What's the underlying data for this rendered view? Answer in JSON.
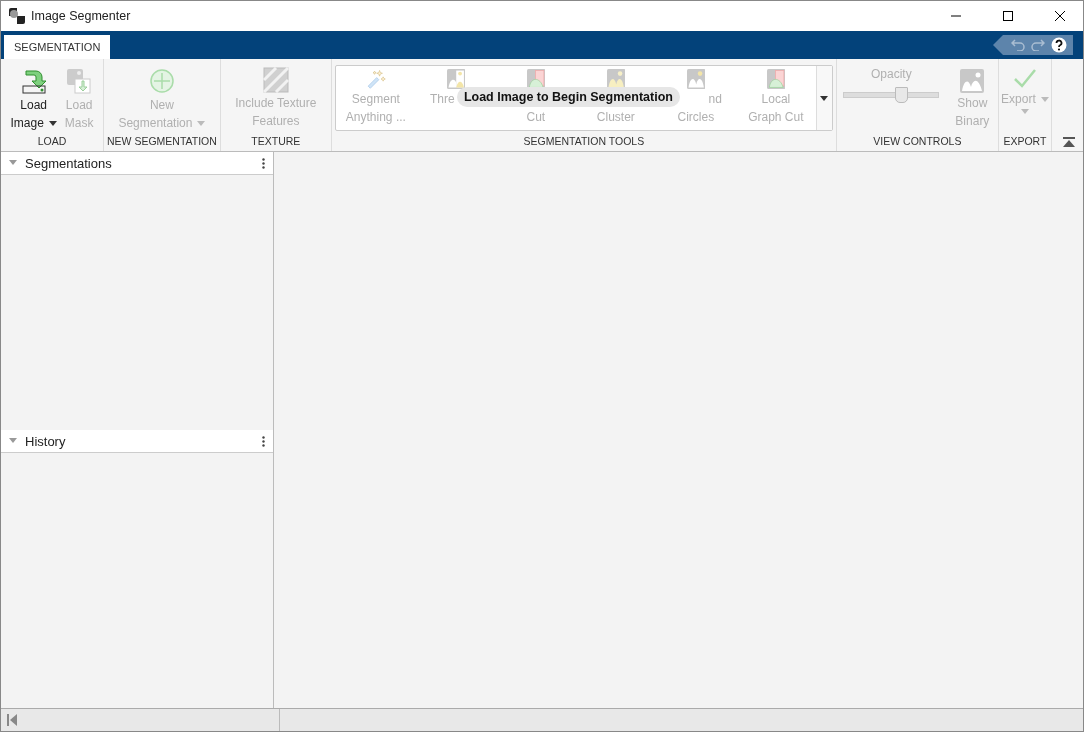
{
  "window": {
    "title": "Image Segmenter"
  },
  "tabs": [
    {
      "label": "SEGMENTATION",
      "selected": true
    }
  ],
  "sections": [
    {
      "label": "LOAD",
      "buttons": [
        {
          "kind": "load-image",
          "lines": [
            "Load",
            "Image"
          ],
          "dropdown": true,
          "disabled": false
        },
        {
          "kind": "load-mask",
          "lines": [
            "Load",
            "Mask"
          ],
          "dropdown": false,
          "disabled": true
        }
      ]
    },
    {
      "label": "NEW SEGMENTATION",
      "buttons": [
        {
          "kind": "new",
          "lines": [
            "New",
            "Segmentation"
          ],
          "dropdown": true,
          "disabled": true
        }
      ]
    },
    {
      "label": "TEXTURE",
      "buttons": [
        {
          "kind": "texture",
          "lines": [
            "Include Texture",
            "Features"
          ],
          "dropdown": false,
          "disabled": true
        }
      ]
    }
  ],
  "gallery": {
    "label": "SEGMENTATION TOOLS",
    "tools": [
      {
        "kind": "wand",
        "line1": "Segment",
        "line2": "Anything ..."
      },
      {
        "kind": "threshold",
        "line1": "Thre"
      },
      {
        "kind": "graph",
        "line2": "Cut"
      },
      {
        "kind": "cluster",
        "line2": "Cluster"
      },
      {
        "kind": "circles",
        "line1": "nd",
        "line2": "Circles"
      },
      {
        "kind": "graph",
        "line1": "Local",
        "line2": "Graph Cut"
      }
    ],
    "overlay": "Load Image to Begin Segmentation"
  },
  "view_controls": {
    "label": "VIEW CONTROLS",
    "opacity": {
      "label": "Opacity",
      "level": 0.6,
      "disabled": true
    },
    "show_binary": {
      "lines": [
        "Show",
        "Binary"
      ],
      "disabled": true
    }
  },
  "export": {
    "label": "EXPORT",
    "button": {
      "lines": [
        "Export"
      ],
      "dropdown": true,
      "disabled": true
    }
  },
  "panels": [
    {
      "title": "Segmentations",
      "expanded": true
    },
    {
      "title": "History",
      "expanded": true
    }
  ]
}
